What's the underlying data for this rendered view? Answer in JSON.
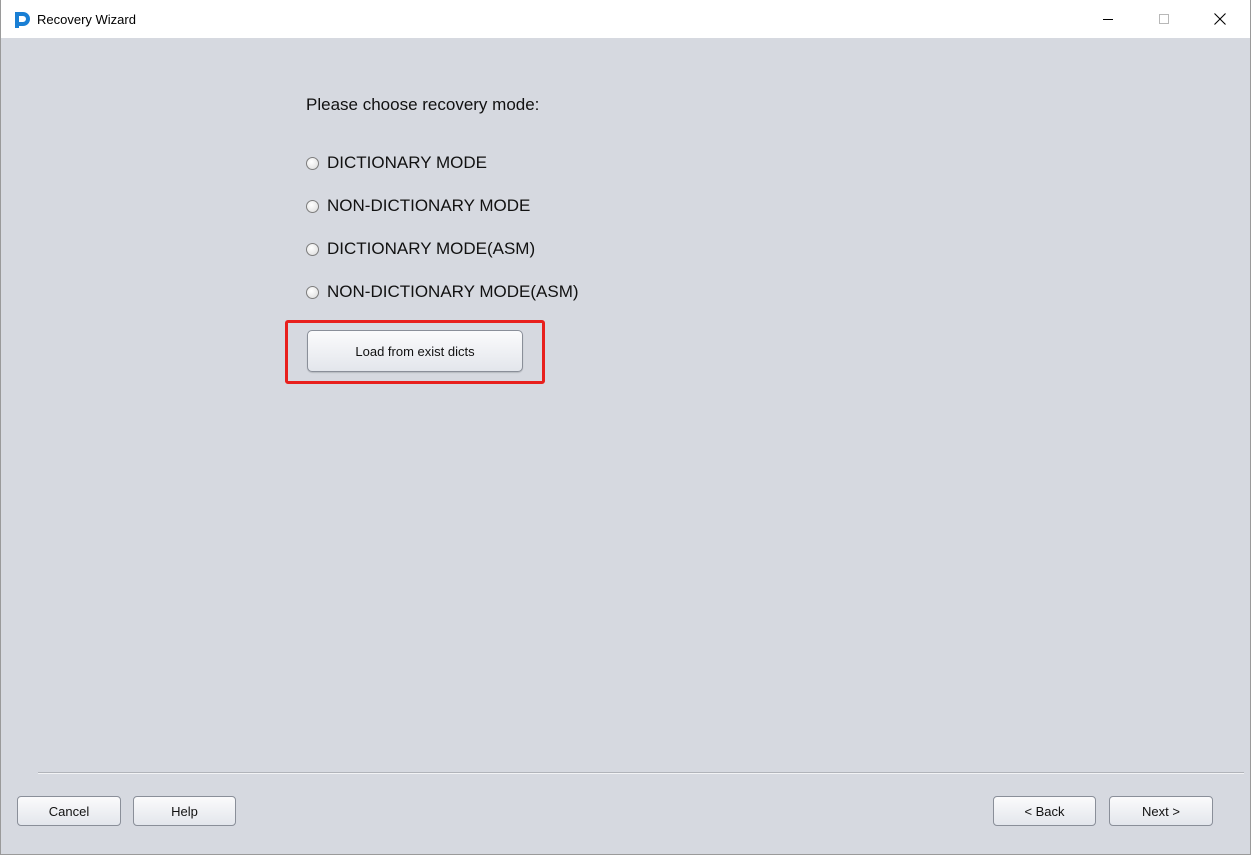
{
  "window": {
    "title": "Recovery Wizard",
    "app_icon": "p-logo-icon",
    "controls": [
      "minimize-icon",
      "maximize-icon",
      "close-icon"
    ]
  },
  "main": {
    "prompt": "Please choose recovery mode:",
    "options": [
      {
        "label": "DICTIONARY MODE",
        "selected": false
      },
      {
        "label": "NON-DICTIONARY MODE",
        "selected": false
      },
      {
        "label": "DICTIONARY MODE(ASM)",
        "selected": false
      },
      {
        "label": "NON-DICTIONARY MODE(ASM)",
        "selected": false
      }
    ],
    "load_button": "Load from exist dicts",
    "highlight_color": "#e8201d"
  },
  "footer": {
    "cancel": "Cancel",
    "help": "Help",
    "back": "< Back",
    "next": "Next >"
  },
  "colors": {
    "background": "#d6d9e0",
    "titlebar": "#ffffff",
    "accent": "#1a7fd4"
  }
}
